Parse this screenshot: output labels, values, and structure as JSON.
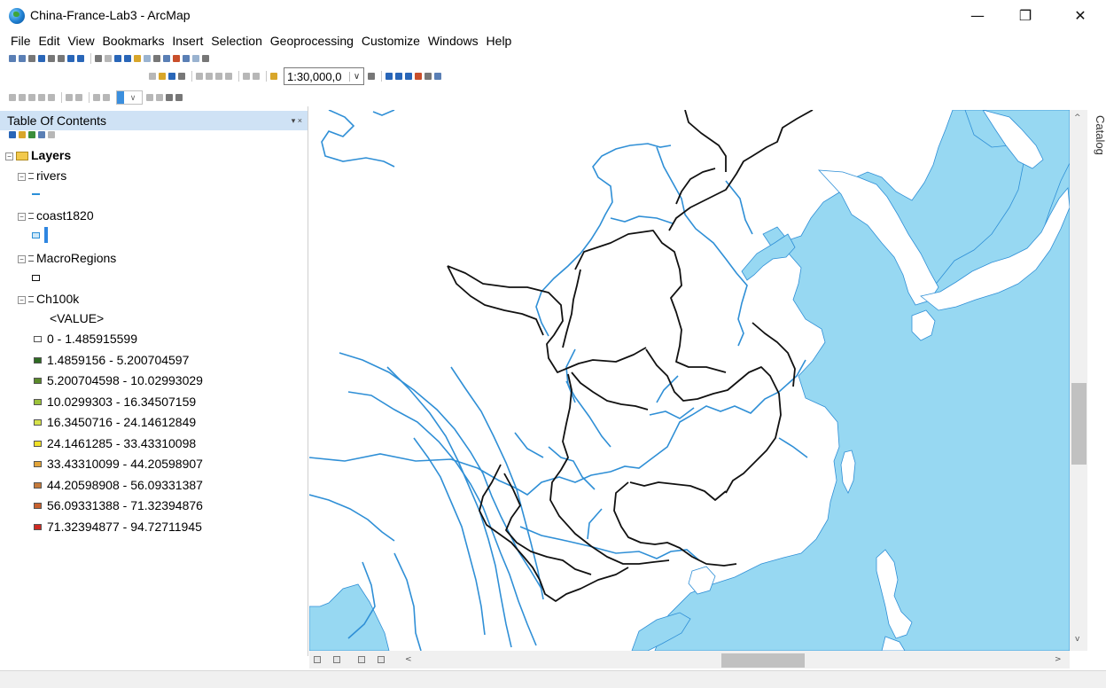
{
  "window": {
    "title": "China-France-Lab3 - ArcMap",
    "minimize": "—",
    "maximize": "❐",
    "close": "✕"
  },
  "menu": [
    "File",
    "Edit",
    "View",
    "Bookmarks",
    "Insert",
    "Selection",
    "Geoprocessing",
    "Customize",
    "Windows",
    "Help"
  ],
  "toolbar": {
    "scale_value": "1:30,000,0",
    "scale_arrow": "∨"
  },
  "toc": {
    "title": "Table Of Contents",
    "pin": "▾ ×",
    "frame_label": "Layers",
    "layers": {
      "rivers": "rivers",
      "coast": "coast1820",
      "regions": "MacroRegions",
      "raster": "Ch100k"
    },
    "raster_field": "<VALUE>",
    "classes": [
      {
        "label": "0 - 1.485915599",
        "color": "#ffffff"
      },
      {
        "label": "1.4859156 - 5.200704597",
        "color": "#2e6b22"
      },
      {
        "label": "5.200704598 - 10.02993029",
        "color": "#5a8a2a"
      },
      {
        "label": "10.0299303 - 16.34507159",
        "color": "#9cc23a"
      },
      {
        "label": "16.3450716 - 24.14612849",
        "color": "#d6e24a"
      },
      {
        "label": "24.1461285 - 33.43310098",
        "color": "#f0e028"
      },
      {
        "label": "33.43310099 - 44.20598907",
        "color": "#e2a43a"
      },
      {
        "label": "44.20598908 - 56.09331387",
        "color": "#c57a3b"
      },
      {
        "label": "56.09331388 - 71.32394876",
        "color": "#c8612e"
      },
      {
        "label": "71.32394877 - 94.72711945",
        "color": "#cf2a22"
      }
    ]
  },
  "map": {
    "water_color": "#97d8f2",
    "river_color": "#2f8fd6",
    "boundary_color": "#111111"
  },
  "catalog_label": "Catalog",
  "scroll": {
    "up": "^",
    "down": "v",
    "left": "<",
    "right": ">"
  }
}
